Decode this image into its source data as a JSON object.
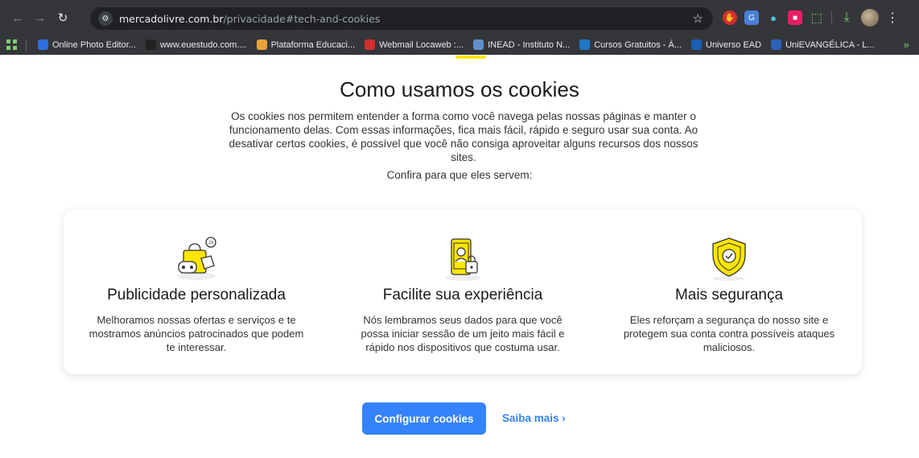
{
  "browser": {
    "url_host": "mercadolivre.com.br",
    "url_path": "/privacidade#tech-and-cookies",
    "bookmarks": [
      {
        "label": "Online Photo Editor...",
        "icon": "photo-editor-icon",
        "color": "#2f6fe0"
      },
      {
        "label": "www.euestudo.com....",
        "icon": "euestudo-icon",
        "color": "#222222"
      },
      {
        "label": "Plataforma Educaci...",
        "icon": "star-bookmark-icon",
        "color": "#e8a33b"
      },
      {
        "label": "Webmail Locaweb :...",
        "icon": "webmail-icon",
        "color": "#d32f2f"
      },
      {
        "label": "INEAD - Instituto N...",
        "icon": "inead-icon",
        "color": "#5f8fc9"
      },
      {
        "label": "Cursos Gratuitos - Á...",
        "icon": "cursos-icon",
        "color": "#1f78c2"
      },
      {
        "label": "Universo EAD",
        "icon": "universo-icon",
        "color": "#1a5fb4"
      },
      {
        "label": "UniEVANGÉLICA - L...",
        "icon": "unievangelica-icon",
        "color": "#2a62b8"
      }
    ]
  },
  "page": {
    "title": "Como usamos os cookies",
    "intro": "Os cookies nos permitem entender a forma como você navega pelas nossas páginas e manter o funcionamento delas. Com essas informações, fica mais fácil, rápido e seguro usar sua conta. Ao desativar certos cookies, é possível que você não consiga aproveitar alguns recursos dos nossos sites.",
    "confira": "Confira para que eles servem:",
    "features": [
      {
        "title": "Publicidade personalizada",
        "text": "Melhoramos nossas ofertas e serviços e te mostramos anúncios patrocinados que podem te interessar.",
        "icon": "shopping-ads-icon"
      },
      {
        "title": "Facilite sua experiência",
        "text": "Nós lembramos seus dados para que você possa iniciar sessão de um jeito mais fácil e rápido nos dispositivos que costuma usar.",
        "icon": "phone-lock-icon"
      },
      {
        "title": "Mais segurança",
        "text": "Eles reforçam a segurança do nosso site e protegem sua conta contra possíveis ataques maliciosos.",
        "icon": "shield-check-icon"
      }
    ],
    "primary_button": "Configurar cookies",
    "secondary_link": "Saiba mais ›"
  },
  "colors": {
    "accent": "#3483fa",
    "brand_yellow": "#ffe600"
  }
}
